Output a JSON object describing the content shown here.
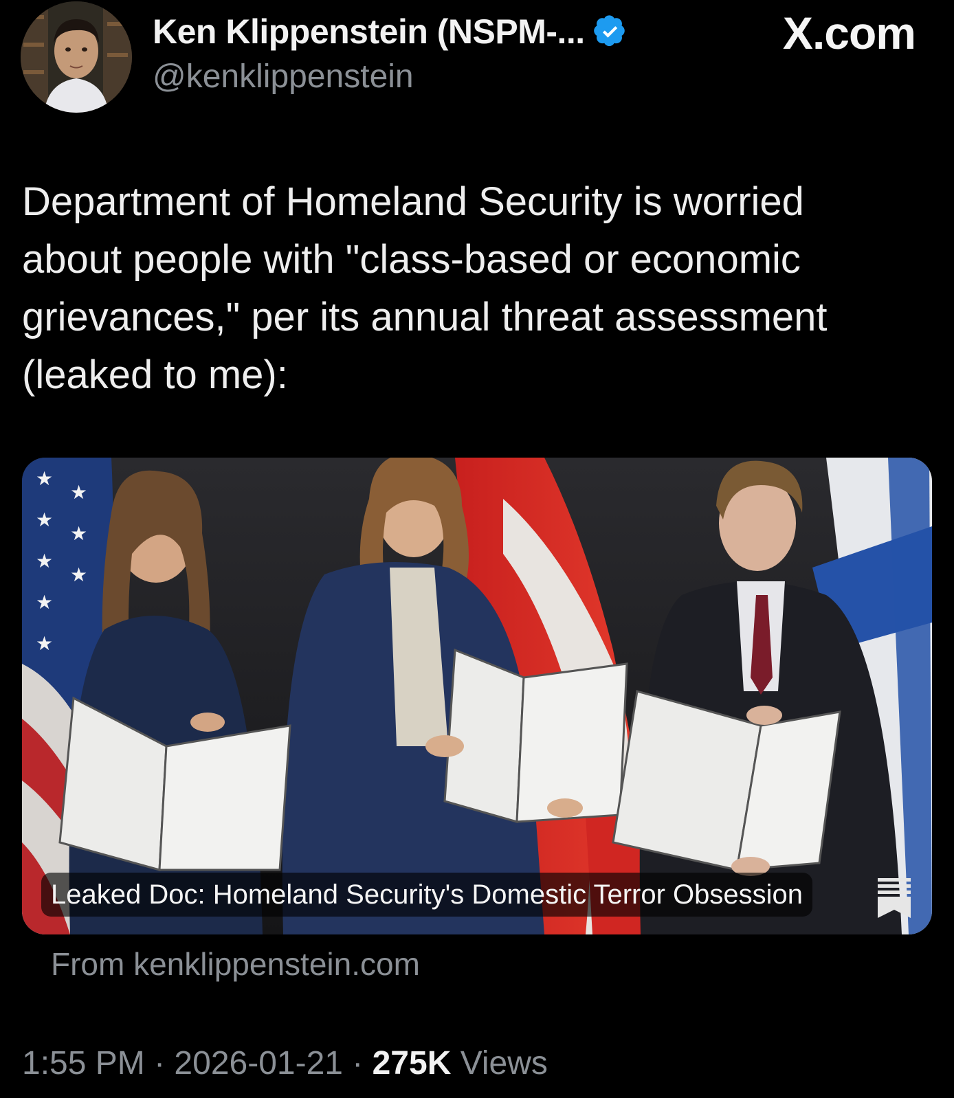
{
  "author": {
    "display_name": "Ken Klippenstein (NSPM-...",
    "handle": "@kenklippenstein",
    "verified_icon": "verified-badge-icon",
    "verified_color": "#1d9bf0"
  },
  "site_label": "X.com",
  "tweet": {
    "text": "Department of Homeland Security is worried\nabout people with \"class-based or economic\ngrievances,\" per its annual threat assessment\n(leaked to me):"
  },
  "link_card": {
    "caption": "Leaked Doc: Homeland Security's Domestic Terror Obsession",
    "source": "From kenklippenstein.com",
    "icon": "bookmark-icon"
  },
  "meta": {
    "time": "1:55 PM",
    "separator": " · ",
    "date": "2026-01-21",
    "views_count": "275K",
    "views_label": "Views"
  }
}
